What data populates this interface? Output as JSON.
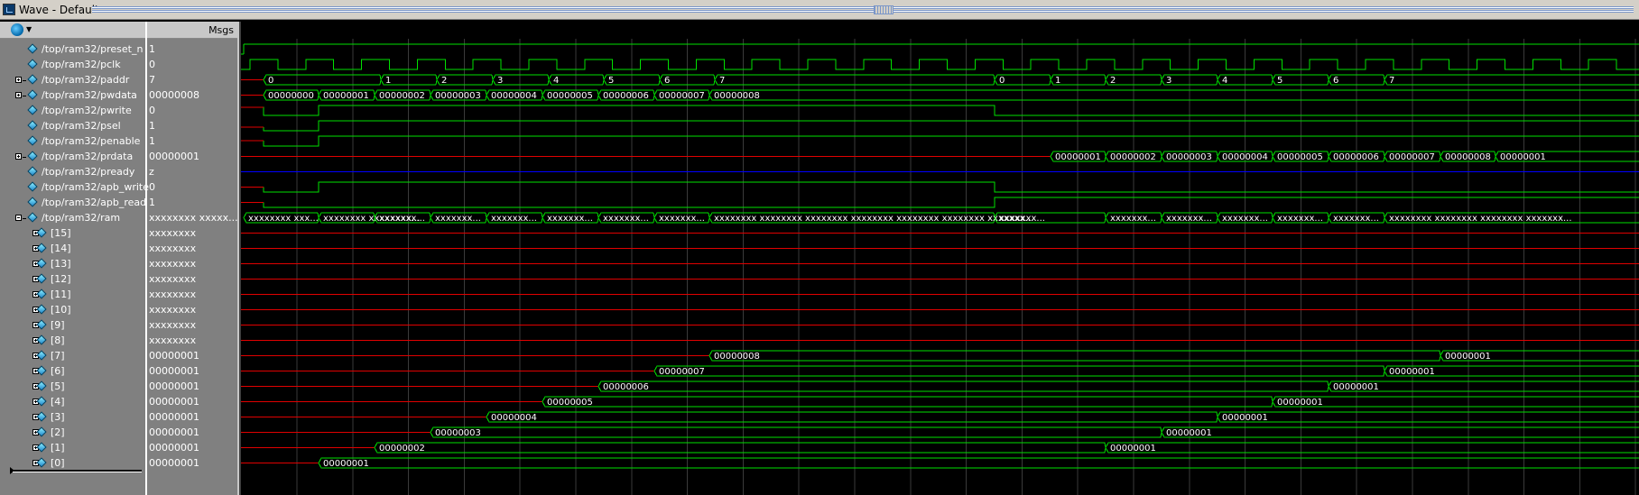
{
  "window": {
    "title": "Wave - Default"
  },
  "headers": {
    "msgs": "Msgs"
  },
  "signals": [
    {
      "name": "/top/ram32/preset_n",
      "value": "1",
      "expandable": false,
      "indent": 0
    },
    {
      "name": "/top/ram32/pclk",
      "value": "0",
      "expandable": false,
      "indent": 0
    },
    {
      "name": "/top/ram32/paddr",
      "value": "7",
      "expandable": true,
      "expanded": false,
      "indent": 0
    },
    {
      "name": "/top/ram32/pwdata",
      "value": "00000008",
      "expandable": true,
      "expanded": false,
      "indent": 0
    },
    {
      "name": "/top/ram32/pwrite",
      "value": "0",
      "expandable": false,
      "indent": 0
    },
    {
      "name": "/top/ram32/psel",
      "value": "1",
      "expandable": false,
      "indent": 0
    },
    {
      "name": "/top/ram32/penable",
      "value": "1",
      "expandable": false,
      "indent": 0
    },
    {
      "name": "/top/ram32/prdata",
      "value": "00000001",
      "expandable": true,
      "expanded": false,
      "indent": 0
    },
    {
      "name": "/top/ram32/pready",
      "value": "z",
      "expandable": false,
      "indent": 0
    },
    {
      "name": "/top/ram32/apb_write",
      "value": "0",
      "expandable": false,
      "indent": 0
    },
    {
      "name": "/top/ram32/apb_read",
      "value": "1",
      "expandable": false,
      "indent": 0
    },
    {
      "name": "/top/ram32/ram",
      "value": "xxxxxxxx xxxxx...",
      "expandable": true,
      "expanded": true,
      "indent": 0
    },
    {
      "name": "[15]",
      "value": "xxxxxxxx",
      "expandable": true,
      "expanded": false,
      "indent": 1
    },
    {
      "name": "[14]",
      "value": "xxxxxxxx",
      "expandable": true,
      "expanded": false,
      "indent": 1
    },
    {
      "name": "[13]",
      "value": "xxxxxxxx",
      "expandable": true,
      "expanded": false,
      "indent": 1
    },
    {
      "name": "[12]",
      "value": "xxxxxxxx",
      "expandable": true,
      "expanded": false,
      "indent": 1
    },
    {
      "name": "[11]",
      "value": "xxxxxxxx",
      "expandable": true,
      "expanded": false,
      "indent": 1
    },
    {
      "name": "[10]",
      "value": "xxxxxxxx",
      "expandable": true,
      "expanded": false,
      "indent": 1
    },
    {
      "name": "[9]",
      "value": "xxxxxxxx",
      "expandable": true,
      "expanded": false,
      "indent": 1
    },
    {
      "name": "[8]",
      "value": "xxxxxxxx",
      "expandable": true,
      "expanded": false,
      "indent": 1
    },
    {
      "name": "[7]",
      "value": "00000001",
      "expandable": true,
      "expanded": false,
      "indent": 1
    },
    {
      "name": "[6]",
      "value": "00000001",
      "expandable": true,
      "expanded": false,
      "indent": 1
    },
    {
      "name": "[5]",
      "value": "00000001",
      "expandable": true,
      "expanded": false,
      "indent": 1
    },
    {
      "name": "[4]",
      "value": "00000001",
      "expandable": true,
      "expanded": false,
      "indent": 1
    },
    {
      "name": "[3]",
      "value": "00000001",
      "expandable": true,
      "expanded": false,
      "indent": 1
    },
    {
      "name": "[2]",
      "value": "00000001",
      "expandable": true,
      "expanded": false,
      "indent": 1
    },
    {
      "name": "[1]",
      "value": "00000001",
      "expandable": true,
      "expanded": false,
      "indent": 1
    },
    {
      "name": "[0]",
      "value": "00000001",
      "expandable": true,
      "expanded": false,
      "indent": 1
    }
  ],
  "waveforms": {
    "paddr_labels": [
      "0",
      "1",
      "2",
      "3",
      "4",
      "5",
      "6",
      "7",
      "0",
      "1",
      "2",
      "3",
      "4",
      "5",
      "6",
      "7"
    ],
    "pwdata_labels": [
      "00000000",
      "00000001",
      "00000002",
      "00000003",
      "00000004",
      "00000005",
      "00000006",
      "00000007",
      "00000008"
    ],
    "prdata_labels": [
      "00000001",
      "00000002",
      "00000003",
      "00000004",
      "00000005",
      "00000006",
      "00000007",
      "00000008",
      "00000001"
    ],
    "ram_labels": [
      "xxxxxxxx xxx...",
      "xxxxxxxx xxxxxxxx...",
      "xxxxxxx...",
      "xxxxxxx...",
      "xxxxxxx...",
      "xxxxxxx...",
      "xxxxxxx...",
      "xxxxxxx...",
      "xxxxxxxx xxxxxxxx xxxxxxxx xxxxxxxx xxxxxxxx xxxxxxxx xxxxxxx...",
      "xxxxxxx...",
      "xxxxxxx...",
      "xxxxxxx...",
      "xxxxxxx...",
      "xxxxxxx...",
      "xxxxxxx...",
      "xxxxxxxx xxxxxxxx xxxxxxxx xxxxxxx..."
    ],
    "ram_written_labels": [
      "00000001",
      "00000002",
      "00000003",
      "00000004",
      "00000005",
      "00000006",
      "00000007",
      "00000008"
    ],
    "ram_readback_label": "00000001"
  },
  "colors": {
    "green": "#00e000",
    "red": "#e00000",
    "blue": "#0000ff",
    "grid": "#3a3a3a",
    "label": "#ffffff"
  }
}
